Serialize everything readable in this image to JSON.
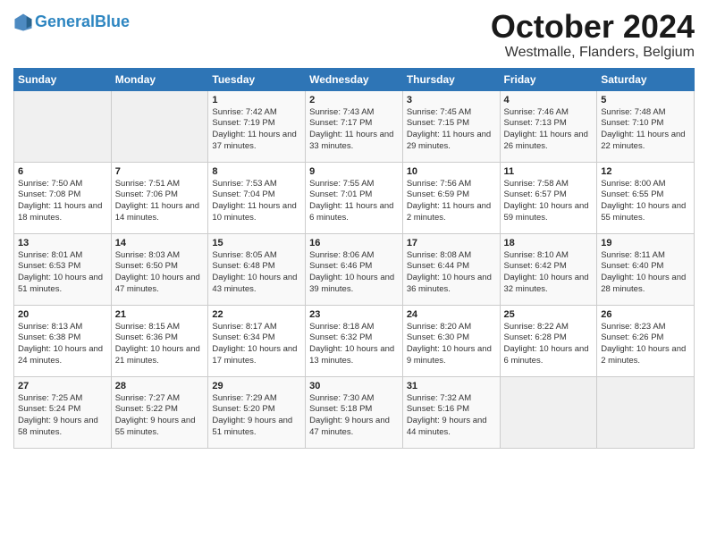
{
  "header": {
    "logo_line1": "General",
    "logo_line2": "Blue",
    "month": "October 2024",
    "location": "Westmalle, Flanders, Belgium"
  },
  "days_of_week": [
    "Sunday",
    "Monday",
    "Tuesday",
    "Wednesday",
    "Thursday",
    "Friday",
    "Saturday"
  ],
  "weeks": [
    [
      {
        "day": "",
        "info": ""
      },
      {
        "day": "",
        "info": ""
      },
      {
        "day": "1",
        "info": "Sunrise: 7:42 AM\nSunset: 7:19 PM\nDaylight: 11 hours and 37 minutes."
      },
      {
        "day": "2",
        "info": "Sunrise: 7:43 AM\nSunset: 7:17 PM\nDaylight: 11 hours and 33 minutes."
      },
      {
        "day": "3",
        "info": "Sunrise: 7:45 AM\nSunset: 7:15 PM\nDaylight: 11 hours and 29 minutes."
      },
      {
        "day": "4",
        "info": "Sunrise: 7:46 AM\nSunset: 7:13 PM\nDaylight: 11 hours and 26 minutes."
      },
      {
        "day": "5",
        "info": "Sunrise: 7:48 AM\nSunset: 7:10 PM\nDaylight: 11 hours and 22 minutes."
      }
    ],
    [
      {
        "day": "6",
        "info": "Sunrise: 7:50 AM\nSunset: 7:08 PM\nDaylight: 11 hours and 18 minutes."
      },
      {
        "day": "7",
        "info": "Sunrise: 7:51 AM\nSunset: 7:06 PM\nDaylight: 11 hours and 14 minutes."
      },
      {
        "day": "8",
        "info": "Sunrise: 7:53 AM\nSunset: 7:04 PM\nDaylight: 11 hours and 10 minutes."
      },
      {
        "day": "9",
        "info": "Sunrise: 7:55 AM\nSunset: 7:01 PM\nDaylight: 11 hours and 6 minutes."
      },
      {
        "day": "10",
        "info": "Sunrise: 7:56 AM\nSunset: 6:59 PM\nDaylight: 11 hours and 2 minutes."
      },
      {
        "day": "11",
        "info": "Sunrise: 7:58 AM\nSunset: 6:57 PM\nDaylight: 10 hours and 59 minutes."
      },
      {
        "day": "12",
        "info": "Sunrise: 8:00 AM\nSunset: 6:55 PM\nDaylight: 10 hours and 55 minutes."
      }
    ],
    [
      {
        "day": "13",
        "info": "Sunrise: 8:01 AM\nSunset: 6:53 PM\nDaylight: 10 hours and 51 minutes."
      },
      {
        "day": "14",
        "info": "Sunrise: 8:03 AM\nSunset: 6:50 PM\nDaylight: 10 hours and 47 minutes."
      },
      {
        "day": "15",
        "info": "Sunrise: 8:05 AM\nSunset: 6:48 PM\nDaylight: 10 hours and 43 minutes."
      },
      {
        "day": "16",
        "info": "Sunrise: 8:06 AM\nSunset: 6:46 PM\nDaylight: 10 hours and 39 minutes."
      },
      {
        "day": "17",
        "info": "Sunrise: 8:08 AM\nSunset: 6:44 PM\nDaylight: 10 hours and 36 minutes."
      },
      {
        "day": "18",
        "info": "Sunrise: 8:10 AM\nSunset: 6:42 PM\nDaylight: 10 hours and 32 minutes."
      },
      {
        "day": "19",
        "info": "Sunrise: 8:11 AM\nSunset: 6:40 PM\nDaylight: 10 hours and 28 minutes."
      }
    ],
    [
      {
        "day": "20",
        "info": "Sunrise: 8:13 AM\nSunset: 6:38 PM\nDaylight: 10 hours and 24 minutes."
      },
      {
        "day": "21",
        "info": "Sunrise: 8:15 AM\nSunset: 6:36 PM\nDaylight: 10 hours and 21 minutes."
      },
      {
        "day": "22",
        "info": "Sunrise: 8:17 AM\nSunset: 6:34 PM\nDaylight: 10 hours and 17 minutes."
      },
      {
        "day": "23",
        "info": "Sunrise: 8:18 AM\nSunset: 6:32 PM\nDaylight: 10 hours and 13 minutes."
      },
      {
        "day": "24",
        "info": "Sunrise: 8:20 AM\nSunset: 6:30 PM\nDaylight: 10 hours and 9 minutes."
      },
      {
        "day": "25",
        "info": "Sunrise: 8:22 AM\nSunset: 6:28 PM\nDaylight: 10 hours and 6 minutes."
      },
      {
        "day": "26",
        "info": "Sunrise: 8:23 AM\nSunset: 6:26 PM\nDaylight: 10 hours and 2 minutes."
      }
    ],
    [
      {
        "day": "27",
        "info": "Sunrise: 7:25 AM\nSunset: 5:24 PM\nDaylight: 9 hours and 58 minutes."
      },
      {
        "day": "28",
        "info": "Sunrise: 7:27 AM\nSunset: 5:22 PM\nDaylight: 9 hours and 55 minutes."
      },
      {
        "day": "29",
        "info": "Sunrise: 7:29 AM\nSunset: 5:20 PM\nDaylight: 9 hours and 51 minutes."
      },
      {
        "day": "30",
        "info": "Sunrise: 7:30 AM\nSunset: 5:18 PM\nDaylight: 9 hours and 47 minutes."
      },
      {
        "day": "31",
        "info": "Sunrise: 7:32 AM\nSunset: 5:16 PM\nDaylight: 9 hours and 44 minutes."
      },
      {
        "day": "",
        "info": ""
      },
      {
        "day": "",
        "info": ""
      }
    ]
  ]
}
